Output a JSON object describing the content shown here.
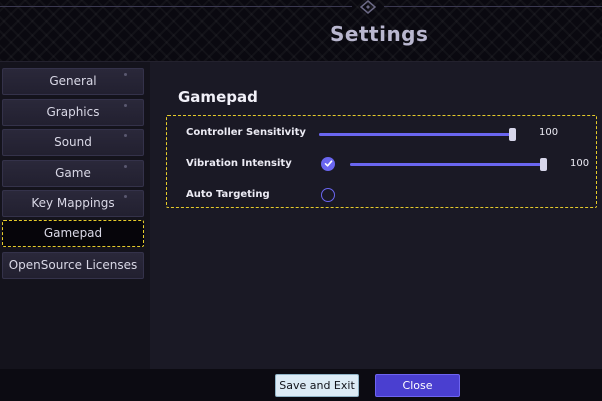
{
  "header": {
    "title": "Settings"
  },
  "sidebar": {
    "items": [
      {
        "label": "General"
      },
      {
        "label": "Graphics"
      },
      {
        "label": "Sound"
      },
      {
        "label": "Game"
      },
      {
        "label": "Key Mappings"
      },
      {
        "label": "Gamepad",
        "active": true
      },
      {
        "label": "OpenSource Licenses"
      }
    ]
  },
  "main": {
    "section_title": "Gamepad",
    "controller_sensitivity": {
      "label": "Controller Sensitivity",
      "value": "100",
      "level": 1.0
    },
    "vibration_intensity": {
      "label": "Vibration Intensity",
      "enabled": true,
      "value": "100",
      "level": 1.0
    },
    "auto_targeting": {
      "label": "Auto Targeting",
      "enabled": false
    }
  },
  "footer": {
    "save_label": "Save and Exit",
    "close_label": "Close"
  },
  "colors": {
    "accent": "#6a66f0",
    "highlight": "#e6cc2a",
    "close_button": "#4a3fd0"
  }
}
